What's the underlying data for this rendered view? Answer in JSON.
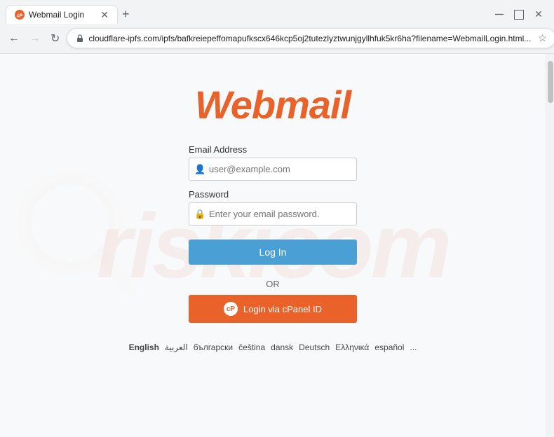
{
  "browser": {
    "tab_title": "Webmail Login",
    "url": "cloudflare-ipfs.com/ipfs/bafkreiepeffomapufkscx646kcp5oj2tutezlyztwunjgyllhfuk5kr6ha?filename=WebmailLogin.html...",
    "new_tab_label": "+",
    "minimize_label": "—",
    "maximize_label": "□",
    "close_label": "✕"
  },
  "page": {
    "logo_text": "Webmail",
    "email_label": "Email Address",
    "email_placeholder": "user@example.com",
    "password_label": "Password",
    "password_placeholder": "Enter your email password.",
    "login_button": "Log In",
    "or_text": "OR",
    "cpanel_button": "Login via cPanel ID",
    "cpanel_icon_text": "cP",
    "watermark_text": "riskicom"
  },
  "languages": [
    {
      "code": "en",
      "label": "English",
      "active": true
    },
    {
      "code": "ar",
      "label": "العربية",
      "active": false
    },
    {
      "code": "bg",
      "label": "български",
      "active": false
    },
    {
      "code": "cs",
      "label": "čeština",
      "active": false
    },
    {
      "code": "da",
      "label": "dansk",
      "active": false
    },
    {
      "code": "de",
      "label": "Deutsch",
      "active": false
    },
    {
      "code": "el",
      "label": "Ελληνικά",
      "active": false
    },
    {
      "code": "es",
      "label": "español",
      "active": false
    },
    {
      "code": "more",
      "label": "...",
      "active": false
    }
  ]
}
